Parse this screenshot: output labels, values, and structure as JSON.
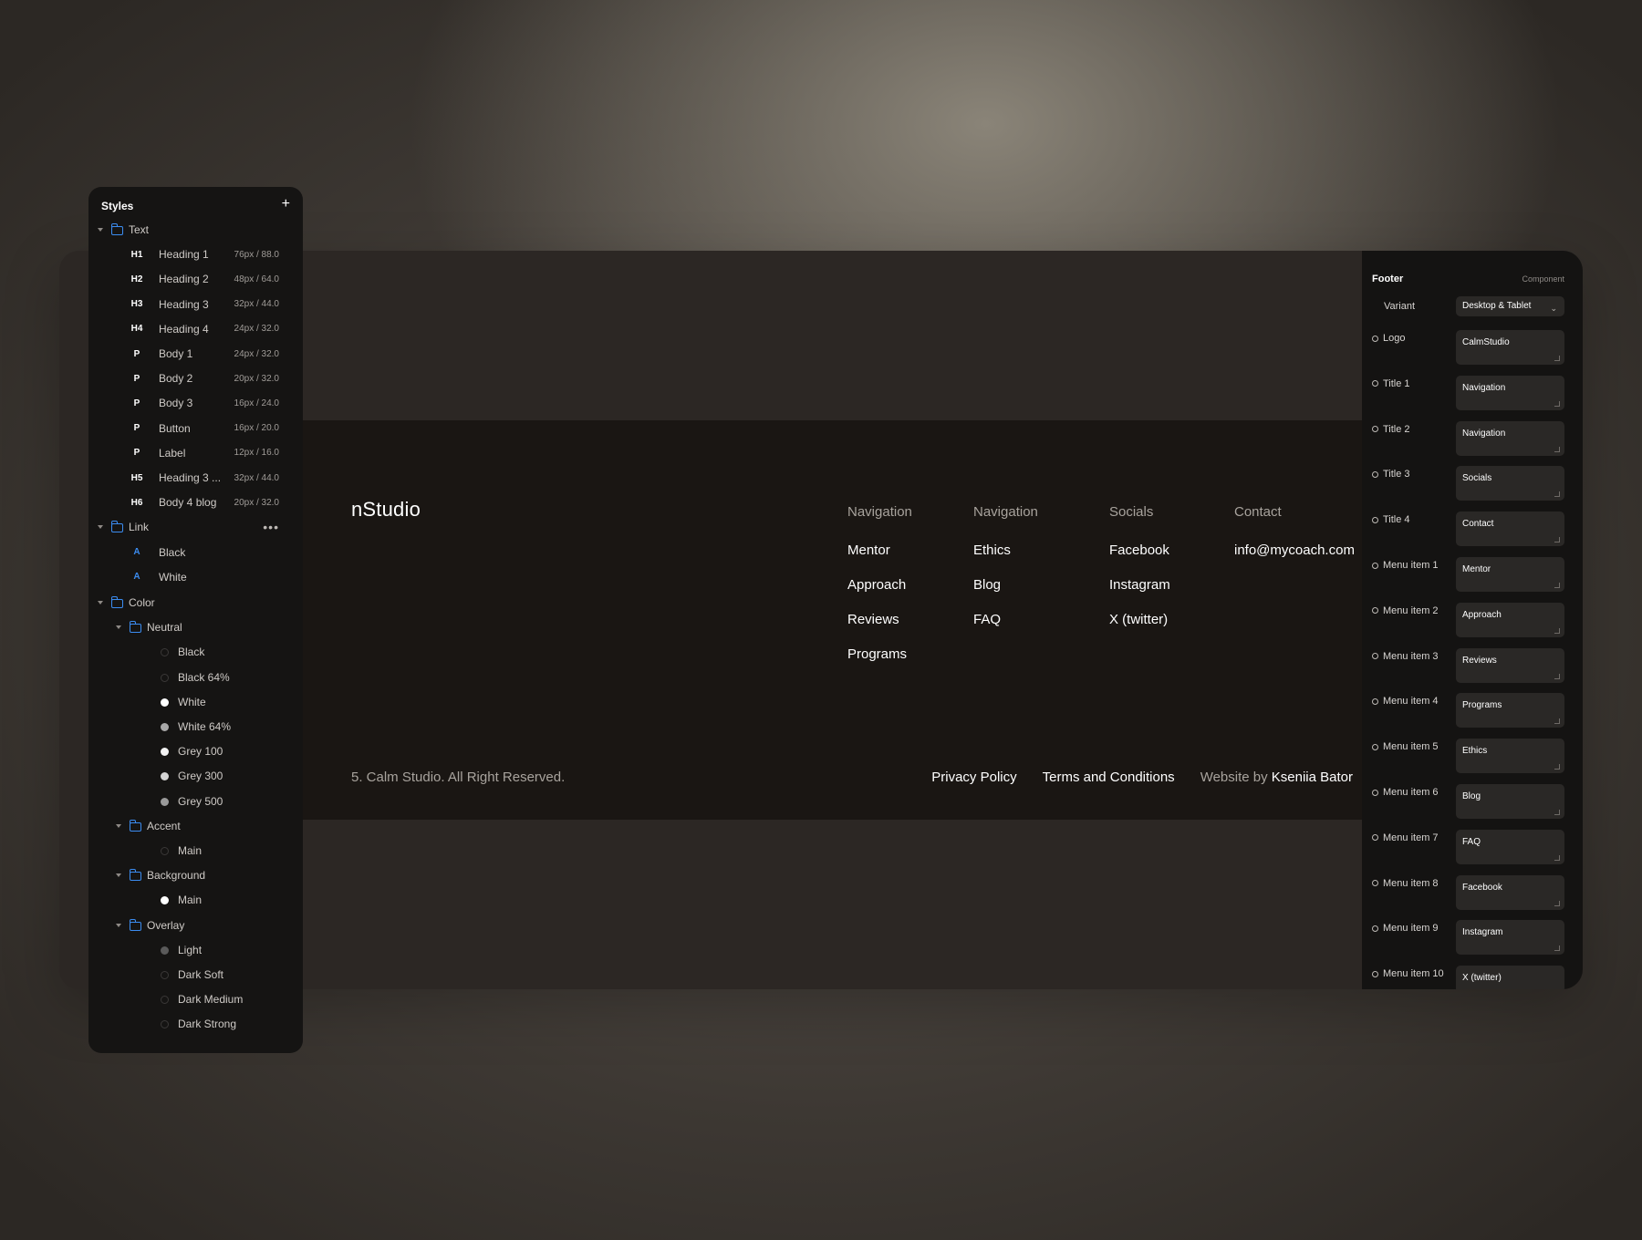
{
  "footer": {
    "logo_text": "nStudio",
    "columns": [
      {
        "title": "Navigation",
        "items": [
          "Mentor",
          "Approach",
          "Reviews",
          "Programs"
        ]
      },
      {
        "title": "Navigation",
        "items": [
          "Ethics",
          "Blog",
          "FAQ"
        ]
      },
      {
        "title": "Socials",
        "items": [
          "Facebook",
          "Instagram",
          "X (twitter)"
        ]
      },
      {
        "title": "Contact",
        "items": [
          "info@mycoach.com"
        ]
      }
    ],
    "copyright": "5. Calm Studio. All Right Reserved.",
    "legal": {
      "privacy": "Privacy Policy",
      "terms": "Terms and Conditions",
      "credit_prefix": "Website by ",
      "credit_name": "Kseniia Bator"
    }
  },
  "styles_panel": {
    "title": "Styles",
    "add_icon": "+",
    "groups": {
      "text": {
        "label": "Text",
        "items": [
          {
            "tag": "H1",
            "label": "Heading 1",
            "meta": "76px / 88.0"
          },
          {
            "tag": "H2",
            "label": "Heading 2",
            "meta": "48px / 64.0"
          },
          {
            "tag": "H3",
            "label": "Heading 3",
            "meta": "32px / 44.0"
          },
          {
            "tag": "H4",
            "label": "Heading 4",
            "meta": "24px / 32.0"
          },
          {
            "tag": "P",
            "label": "Body 1",
            "meta": "24px / 32.0"
          },
          {
            "tag": "P",
            "label": "Body 2",
            "meta": "20px / 32.0"
          },
          {
            "tag": "P",
            "label": "Body 3",
            "meta": "16px / 24.0"
          },
          {
            "tag": "P",
            "label": "Button",
            "meta": "16px / 20.0"
          },
          {
            "tag": "P",
            "label": "Label",
            "meta": "12px / 16.0"
          },
          {
            "tag": "H5",
            "label": "Heading 3 ...",
            "meta": "32px / 44.0"
          },
          {
            "tag": "H6",
            "label": "Body 4 blog",
            "meta": "20px / 32.0"
          }
        ]
      },
      "link": {
        "label": "Link",
        "more": "•••",
        "items": [
          {
            "tag": "A",
            "label": "Black"
          },
          {
            "tag": "A",
            "label": "White"
          }
        ]
      },
      "color": {
        "label": "Color",
        "neutral": {
          "label": "Neutral",
          "items": [
            {
              "label": "Black",
              "color": "#1a1a1a"
            },
            {
              "label": "Black 64%",
              "color": "#2a2a2a"
            },
            {
              "label": "White",
              "color": "#ffffff"
            },
            {
              "label": "White 64%",
              "color": "#a8a8a8"
            },
            {
              "label": "Grey 100",
              "color": "#f2f2f2"
            },
            {
              "label": "Grey 300",
              "color": "#d4d4d4"
            },
            {
              "label": "Grey 500",
              "color": "#9a9a9a"
            }
          ]
        },
        "accent": {
          "label": "Accent",
          "items": [
            {
              "label": "Main",
              "color": "#1e1e1e"
            }
          ]
        },
        "background": {
          "label": "Background",
          "items": [
            {
              "label": "Main",
              "color": "#ffffff"
            }
          ]
        },
        "overlay": {
          "label": "Overlay",
          "items": [
            {
              "label": "Light",
              "color": "#5a5a5a"
            },
            {
              "label": "Dark Soft",
              "color": "#1c1c1c"
            },
            {
              "label": "Dark Medium",
              "color": "#1c1c1c"
            },
            {
              "label": "Dark Strong",
              "color": "#1c1c1c"
            }
          ]
        }
      }
    }
  },
  "properties_panel": {
    "title": "Footer",
    "kind": "Component",
    "variant_label": "Variant",
    "variant_value": "Desktop & Tablet",
    "fields": [
      {
        "label": "Logo",
        "value": "CalmStudio"
      },
      {
        "label": "Title 1",
        "value": "Navigation"
      },
      {
        "label": "Title 2",
        "value": "Navigation"
      },
      {
        "label": "Title 3",
        "value": "Socials"
      },
      {
        "label": "Title 4",
        "value": "Contact"
      },
      {
        "label": "Menu item 1",
        "value": "Mentor"
      },
      {
        "label": "Menu item 2",
        "value": "Approach"
      },
      {
        "label": "Menu item 3",
        "value": "Reviews"
      },
      {
        "label": "Menu item 4",
        "value": "Programs"
      },
      {
        "label": "Menu item 5",
        "value": "Ethics"
      },
      {
        "label": "Menu item 6",
        "value": "Blog"
      },
      {
        "label": "Menu item 7",
        "value": "FAQ"
      },
      {
        "label": "Menu item 8",
        "value": "Facebook"
      },
      {
        "label": "Menu item 9",
        "value": "Instagram"
      },
      {
        "label": "Menu item 10",
        "value": "X (twitter)"
      }
    ]
  }
}
